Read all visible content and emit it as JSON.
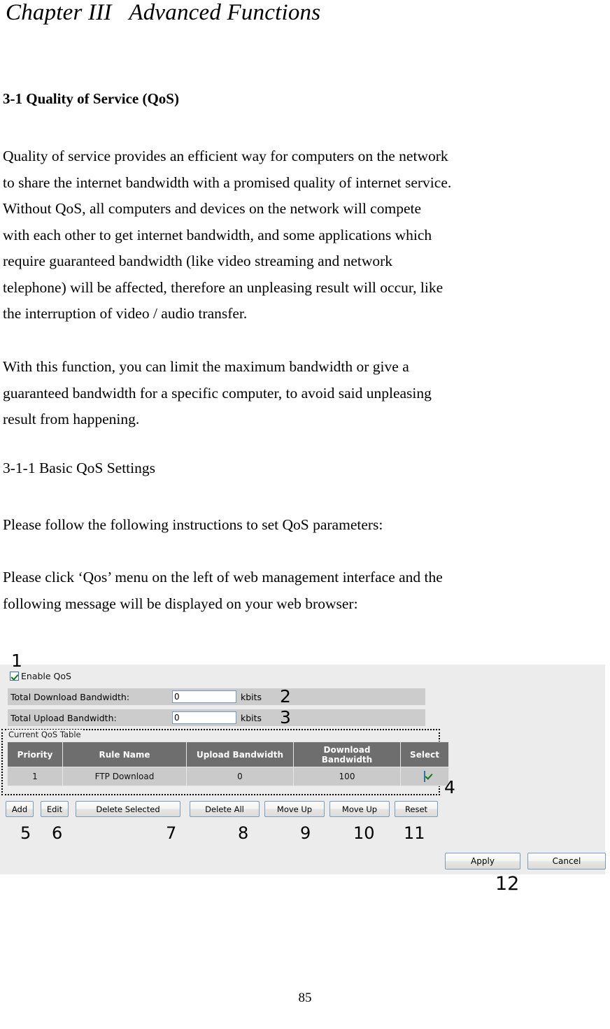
{
  "document": {
    "chapter_title": "Chapter III   Advanced Functions",
    "section_heading": "3-1 Quality of Service (QoS)",
    "paragraph_1": [
      "Quality of service provides an efficient way for computers on the network",
      "to share the internet bandwidth with a promised quality of internet service.",
      "Without QoS, all computers and devices on the network will compete",
      "with each other to get internet bandwidth, and some applications which",
      "require guaranteed bandwidth (like video streaming and network",
      "telephone) will be affected, therefore an unpleasing result will occur, like",
      "the interruption of video / audio transfer."
    ],
    "paragraph_2": [
      "With this function, you can limit the maximum bandwidth or give a",
      "guaranteed bandwidth for a specific computer, to avoid said unpleasing",
      "result from happening."
    ],
    "subheading": "3-1-1 Basic QoS Settings",
    "paragraph_3": [
      "Please follow the following instructions to set QoS parameters:"
    ],
    "paragraph_4": [
      "Please click ‘Qos’ menu on the left of web management interface and the",
      "following message will be displayed on your web browser:"
    ],
    "page_number": "85"
  },
  "screenshot": {
    "enable_qos": {
      "label": "Enable QoS",
      "checked": true
    },
    "fields": [
      {
        "label": "Total Download Bandwidth:",
        "value": "0",
        "unit": "kbits"
      },
      {
        "label": "Total Upload Bandwidth:",
        "value": "0",
        "unit": "kbits"
      }
    ],
    "table": {
      "legend": "Current QoS Table",
      "headers": [
        "Priority",
        "Rule Name",
        "Upload Bandwidth",
        "Download Bandwidth",
        "Select"
      ],
      "header_download_line1": "Download",
      "header_download_line2": "Bandwidth",
      "rows": [
        {
          "priority": "1",
          "rule_name": "FTP Download",
          "upload_bandwidth": "0",
          "download_bandwidth": "100",
          "selected": true
        }
      ]
    },
    "buttons": {
      "add": "Add",
      "edit": "Edit",
      "delete_selected": "Delete Selected",
      "delete_all": "Delete All",
      "move_up_1": "Move Up",
      "move_up_2": "Move Up",
      "reset": "Reset",
      "apply": "Apply",
      "cancel": "Cancel"
    },
    "colors": {
      "panel_bg": "#ececec",
      "row_bg": "#cccccc",
      "table_header_bg": "#6e6e6e",
      "table_row_bg": "#cacaca",
      "check_green": "#107c10",
      "input_border": "#7a9bbf"
    }
  },
  "callouts": {
    "n1": "1",
    "n2": "2",
    "n3": "3",
    "n4": "4",
    "n5": "5",
    "n6": "6",
    "n7": "7",
    "n8": "8",
    "n9": "9",
    "n10": "10",
    "n11": "11",
    "n12": "12"
  }
}
